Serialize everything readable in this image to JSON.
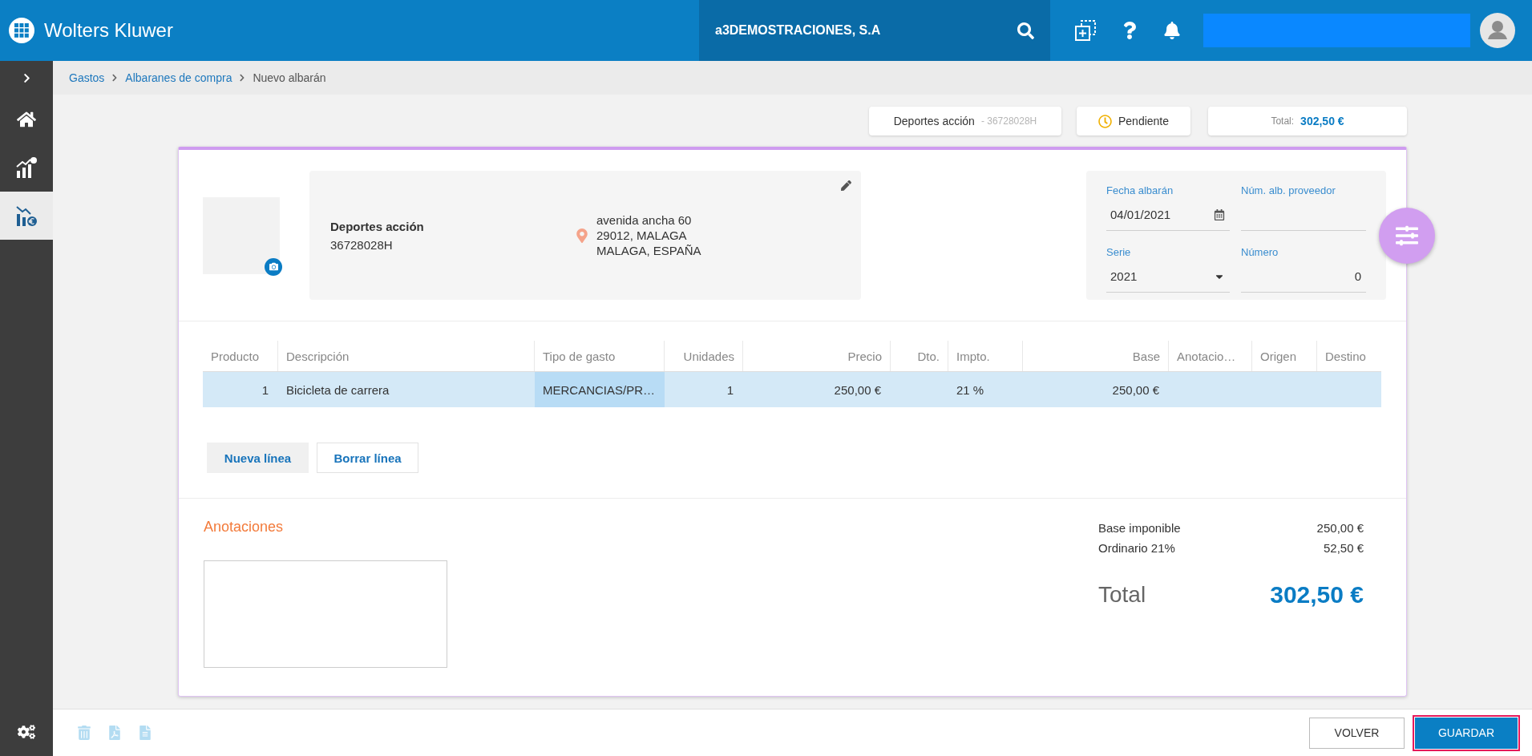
{
  "header": {
    "brand": "Wolters Kluwer",
    "company": "a3DEMOSTRACIONES, S.A"
  },
  "sidebar": {
    "items": [
      {
        "kind": "home",
        "selected": false
      },
      {
        "kind": "stats",
        "selected": false
      },
      {
        "kind": "expenses",
        "selected": true
      }
    ]
  },
  "breadcrumb": [
    {
      "label": "Gastos",
      "current": false
    },
    {
      "label": "Albaranes de compra",
      "current": false
    },
    {
      "label": "Nuevo albarán",
      "current": true
    }
  ],
  "summary": {
    "supplier": {
      "name": "Deportes acción",
      "tax_id": "- 36728028H"
    },
    "status": "Pendiente",
    "total": {
      "label": "Total:",
      "value": "302,50 €"
    }
  },
  "supplier_card": {
    "name": "Deportes acción",
    "tax_id": "36728028H",
    "address": [
      "avenida ancha 60",
      "29012, MALAGA",
      "MALAGA, ESPAÑA"
    ]
  },
  "document_fields": [
    {
      "kind": "date",
      "label": "Fecha albarán",
      "value": "04/01/2021"
    },
    {
      "kind": "text",
      "label": "Núm. alb. proveedor"
    },
    {
      "kind": "select",
      "label": "Serie",
      "value": "2021"
    },
    {
      "kind": "number",
      "label": "Número",
      "value": "0"
    }
  ],
  "table": {
    "columns": [
      "Producto",
      "Descripción",
      "Tipo de gasto",
      "Unidades",
      "Precio",
      "Dto.",
      "Impto.",
      "Base",
      "Anotacio…",
      "Origen",
      "Destino"
    ],
    "rows": [
      {
        "selected": true,
        "cells": [
          {
            "text": "1",
            "focused": false
          },
          {
            "text": "Bicicleta de carrera",
            "focused": false
          },
          {
            "text": "MERCANCIAS/PR…",
            "focused": true
          },
          {
            "text": "1",
            "focused": false
          },
          {
            "text": "250,00 €",
            "focused": false
          },
          {
            "focused": false
          },
          {
            "text": "21 %",
            "focused": false
          },
          {
            "text": "250,00 €",
            "focused": false
          },
          {
            "focused": false
          },
          {
            "focused": false
          },
          {
            "focused": false
          }
        ]
      }
    ]
  },
  "line_buttons": [
    {
      "kind": "filled",
      "label": "Nueva línea"
    },
    {
      "kind": "outlined",
      "label": "Borrar línea"
    }
  ],
  "notes": {
    "title": "Anotaciones"
  },
  "totals": {
    "lines": [
      {
        "label": "Base imponible",
        "value": "250,00 €"
      },
      {
        "label": "Ordinario 21%",
        "value": "52,50 €"
      }
    ],
    "total": {
      "label": "Total",
      "value": "302,50 €"
    }
  },
  "footer": {
    "actions": [
      {
        "kind": "delete",
        "disabled": true
      },
      {
        "kind": "pdf",
        "disabled": true
      },
      {
        "kind": "document",
        "disabled": true
      }
    ],
    "buttons": [
      {
        "kind": "secondary",
        "label": "VOLVER",
        "highlighted": false
      },
      {
        "kind": "primary",
        "label": "GUARDAR",
        "highlighted": true
      }
    ]
  }
}
